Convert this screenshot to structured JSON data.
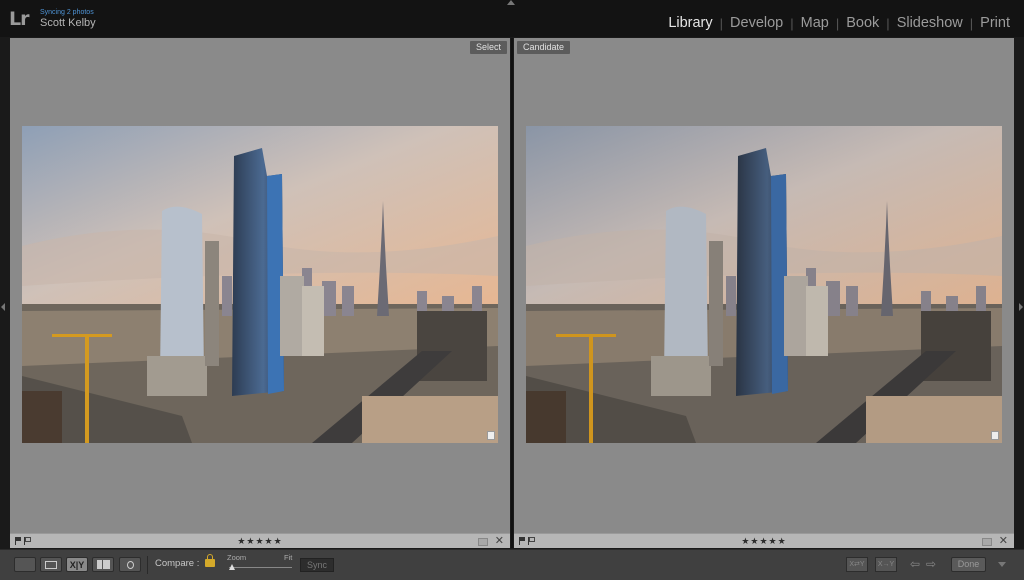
{
  "app": {
    "logo": "Lr",
    "sync_status": "Syncing 2 photos",
    "user_name": "Scott Kelby"
  },
  "modules": {
    "items": [
      "Library",
      "Develop",
      "Map",
      "Book",
      "Slideshow",
      "Print"
    ],
    "active": "Library",
    "separator": "|"
  },
  "compare": {
    "select_label": "Select",
    "candidate_label": "Candidate",
    "select_rating": "★★★★★",
    "candidate_rating": "★★★★★"
  },
  "toolbar": {
    "compare_label": "Compare :",
    "zoom_label": "Zoom",
    "fit_label": "Fit",
    "sync_label": "Sync",
    "swap_label": "X⇄Y",
    "make_select_label": "X→Y",
    "prev_arrow": "⇦",
    "next_arrow": "⇨",
    "done_label": "Done"
  },
  "colors": {
    "accent_blue": "#4f94d6",
    "lock": "#d4a92a",
    "pane_bg": "#8a8a8a"
  },
  "icons": [
    "lr-logo-icon",
    "grid-view-icon",
    "loupe-view-icon",
    "compare-view-icon",
    "survey-view-icon",
    "people-view-icon",
    "lock-icon",
    "flag-icon",
    "close-icon"
  ]
}
